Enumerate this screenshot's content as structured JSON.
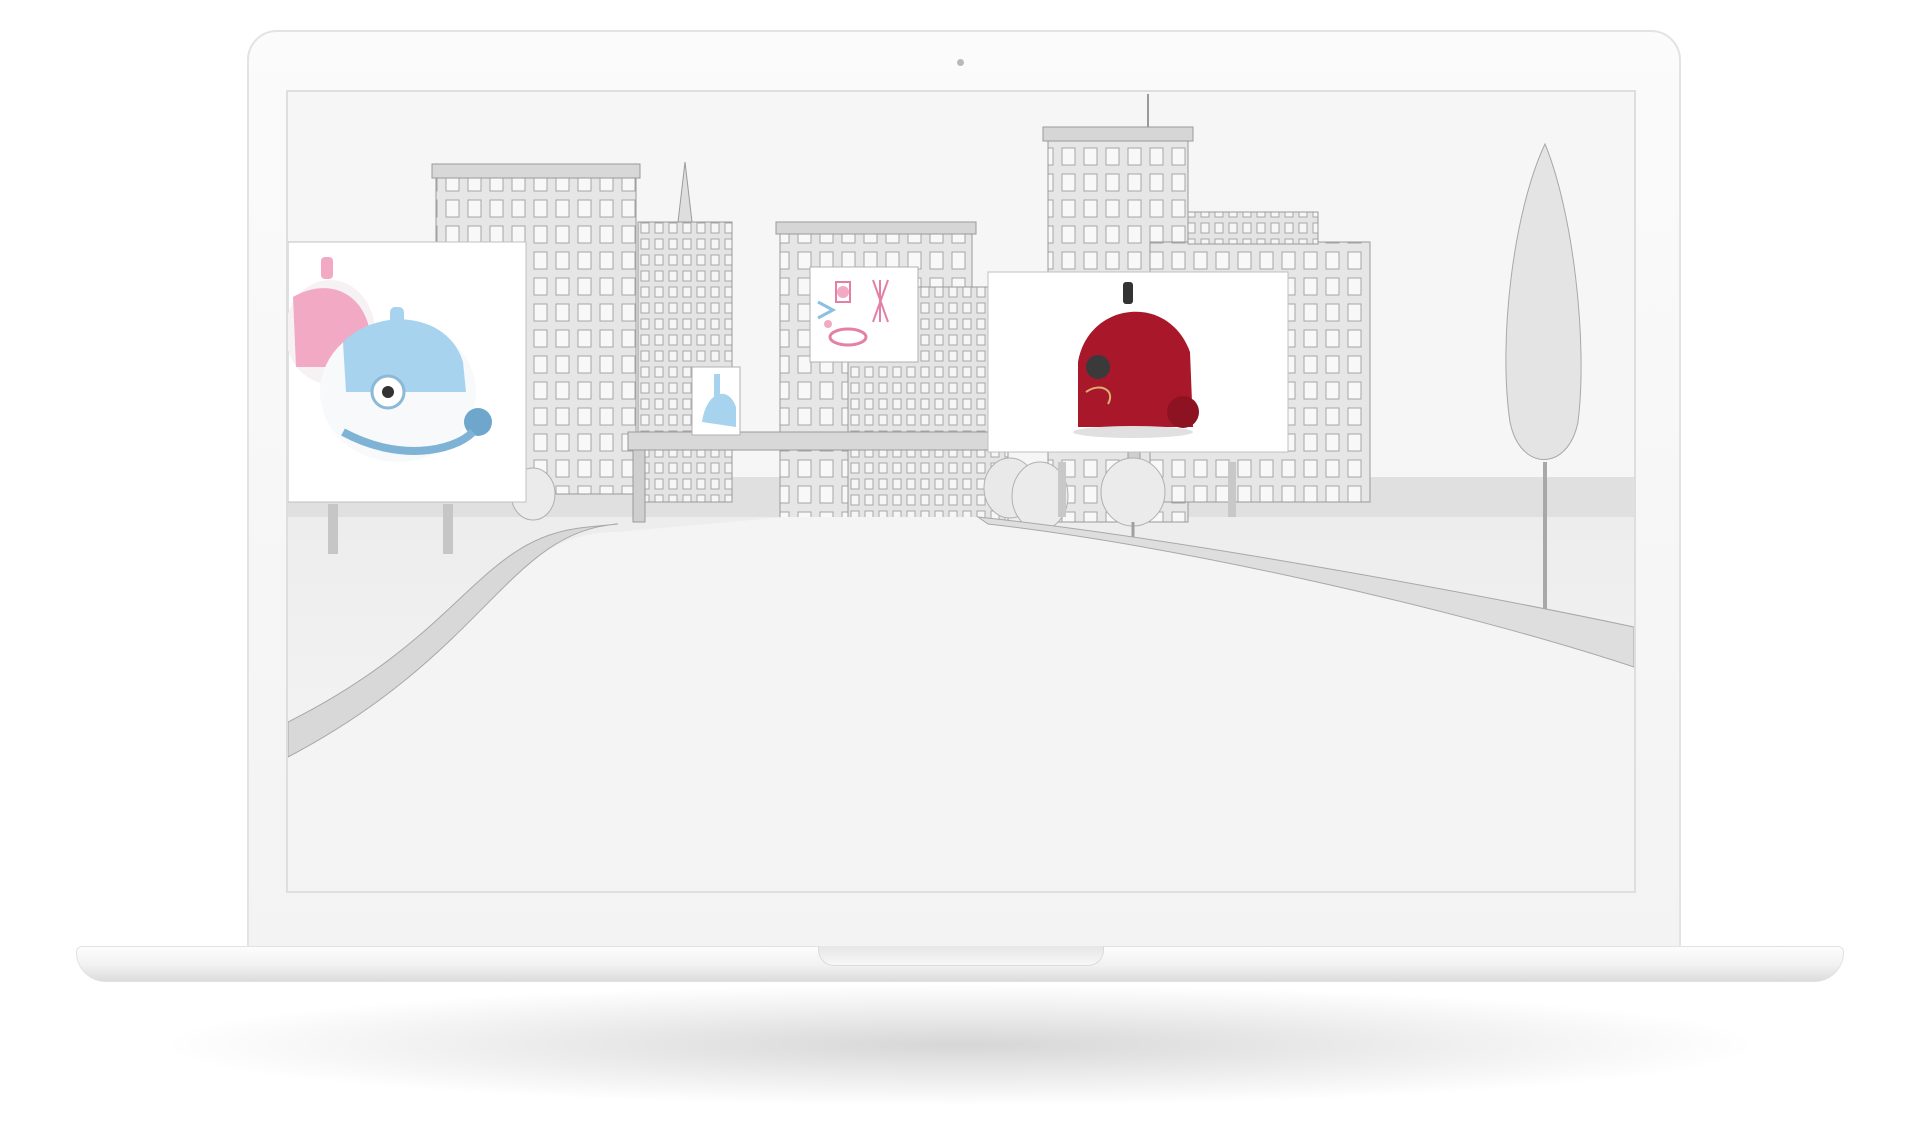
{
  "scene": {
    "device": "laptop",
    "screen_content": "3d-city-street-with-billboards",
    "billboards": [
      {
        "product": "pink-and-blue-garment-steamers"
      },
      {
        "product": "blue-garment-steamer"
      },
      {
        "product": "pink-steamer-accessories"
      },
      {
        "product": "red-garment-steamer"
      }
    ]
  },
  "colors": {
    "body": "#f4f4f4",
    "screen_bg": "#f5f5f5",
    "buildings": "#e2e2e2",
    "accent_pink": "#f2a9c4",
    "accent_blue": "#a8d3ee",
    "accent_red": "#a8182a"
  }
}
